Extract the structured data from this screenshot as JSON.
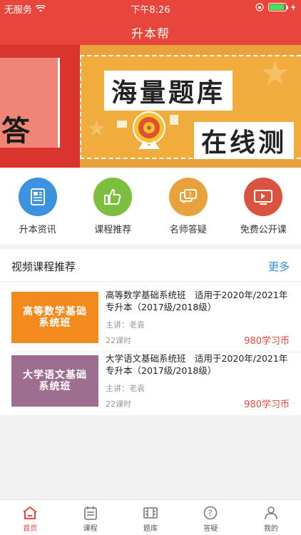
{
  "status_bar": {
    "carrier": "无服务",
    "time": "下午8:26",
    "battery_percent": 0.9
  },
  "nav": {
    "title": "升本帮"
  },
  "banner": {
    "left_text": "答",
    "title_line1": "海量题库",
    "title_line2": "在线测"
  },
  "quick_actions": [
    {
      "label": "升本资讯",
      "icon": "news-icon",
      "color": "#3b93df"
    },
    {
      "label": "课程推荐",
      "icon": "thumbs-up-icon",
      "color": "#7cbf3f"
    },
    {
      "label": "名师答疑",
      "icon": "chat-question-icon",
      "color": "#e9a23b"
    },
    {
      "label": "免费公开课",
      "icon": "video-screen-icon",
      "color": "#d9533e"
    }
  ],
  "course_section": {
    "title": "视频课程推荐",
    "more": "更多",
    "courses": [
      {
        "thumb_line1": "高等数学基础",
        "thumb_line2": "系统班",
        "thumb_color": "#f28a1e",
        "title": "高等数学基础系统班　适用于2020年/2021年专升本（2017级/2018级）",
        "teacher": "主讲：老袁",
        "hours": "22课时",
        "price": "980学习币"
      },
      {
        "thumb_line1": "大学语文基础",
        "thumb_line2": "系统班",
        "thumb_color": "#9e6e90",
        "title": "大学语文基础系统班　适用于2020年/2021年专升本（2017级/2018级）",
        "teacher": "主讲：老袁",
        "hours": "22课时",
        "price": "980学习币"
      }
    ]
  },
  "tabbar": [
    {
      "label": "首页",
      "icon": "home-icon",
      "active": true
    },
    {
      "label": "课程",
      "icon": "course-icon",
      "active": false
    },
    {
      "label": "题库",
      "icon": "question-bank-icon",
      "active": false
    },
    {
      "label": "答疑",
      "icon": "question-icon",
      "active": false
    },
    {
      "label": "我的",
      "icon": "profile-icon",
      "active": false
    }
  ],
  "colors": {
    "brand": "#e8453c",
    "link": "#2f8ee4",
    "price": "#e8453c"
  }
}
